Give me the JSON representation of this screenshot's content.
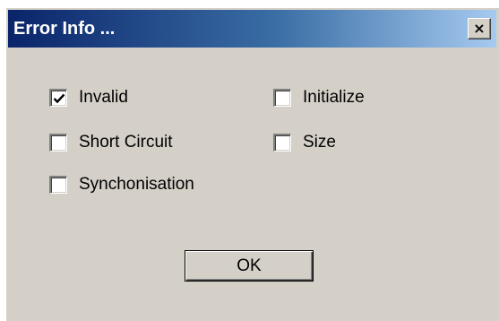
{
  "window": {
    "title": "Error Info ...",
    "close_label": "×",
    "title_gradient": [
      "#0a246a",
      "#a6caf0"
    ],
    "background": "#d4d0c8"
  },
  "options": {
    "invalid": {
      "label": "Invalid",
      "checked": true
    },
    "initialize": {
      "label": "Initialize",
      "checked": false
    },
    "short_circuit": {
      "label": "Short Circuit",
      "checked": false
    },
    "size": {
      "label": "Size",
      "checked": false
    },
    "synchronisation": {
      "label": "Synchonisation",
      "checked": false
    }
  },
  "buttons": {
    "ok_label": "OK"
  }
}
